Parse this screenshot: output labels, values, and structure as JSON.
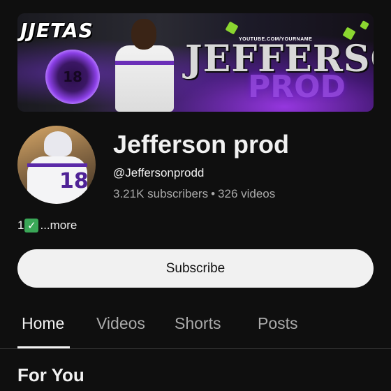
{
  "banner": {
    "tag": "JJETAS",
    "url": "YOUTUBE.COM/YOURNAME",
    "name": "JEFFERSO",
    "sub": "PROD",
    "emblem_number": "18"
  },
  "channel": {
    "name": "Jefferson prod",
    "handle": "@Jeffersonprodd",
    "subscribers": "3.21K subscribers",
    "separator": "•",
    "videos": "326 videos",
    "avatar_number": "18"
  },
  "description": {
    "prefix": "1",
    "check_glyph": "✓",
    "more": "...more"
  },
  "subscribe_label": "Subscribe",
  "tabs": [
    {
      "label": "Home",
      "active": true
    },
    {
      "label": "Videos",
      "active": false
    },
    {
      "label": "Shorts",
      "active": false
    },
    {
      "label": "Posts",
      "active": false
    }
  ],
  "section_title": "For You",
  "colors": {
    "background": "#0f0f0f",
    "subscribe_bg": "#f1f1f1",
    "check_green": "#3aa757",
    "banner_accent": "#9b4de8"
  }
}
